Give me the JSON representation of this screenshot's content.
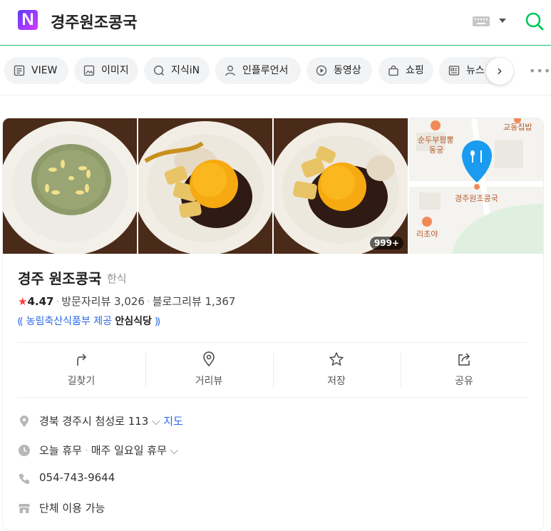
{
  "header": {
    "logo": "N",
    "query": "경주원조콩국"
  },
  "tabs": [
    {
      "label": "VIEW",
      "icon": "view-icon"
    },
    {
      "label": "이미지",
      "icon": "image-icon"
    },
    {
      "label": "지식iN",
      "icon": "knowledge-icon"
    },
    {
      "label": "인플루언서",
      "icon": "influencer-icon"
    },
    {
      "label": "동영상",
      "icon": "video-icon"
    },
    {
      "label": "쇼핑",
      "icon": "shopping-icon"
    },
    {
      "label": "뉴스",
      "icon": "news-icon"
    }
  ],
  "photos": {
    "count_badge": "999+"
  },
  "map": {
    "labels": [
      "교동집밥",
      "순두부짬뽕",
      "동궁",
      "경주원조콩국",
      "리초야"
    ]
  },
  "place": {
    "name": "경주 원조콩국",
    "category": "한식",
    "rating": "4.47",
    "visitor_reviews": "방문자리뷰 3,026",
    "blog_reviews": "블로그리뷰 1,367",
    "cert_text": "농림축산식품부 제공",
    "cert_name": "안심식당"
  },
  "actions": [
    {
      "label": "길찾기",
      "icon": "directions-icon"
    },
    {
      "label": "거리뷰",
      "icon": "street-view-icon"
    },
    {
      "label": "저장",
      "icon": "star-icon"
    },
    {
      "label": "공유",
      "icon": "share-icon"
    }
  ],
  "info": {
    "address": "경북 경주시 첨성로 113",
    "map_link": "지도",
    "hours_status": "오늘 휴무",
    "hours_detail": "매주 일요일 휴무",
    "phone": "054-743-9644",
    "group": "단체 이용 가능"
  },
  "colors": {
    "accent": "#03c75a",
    "link": "#2968e4",
    "star": "#ff3b3b"
  }
}
